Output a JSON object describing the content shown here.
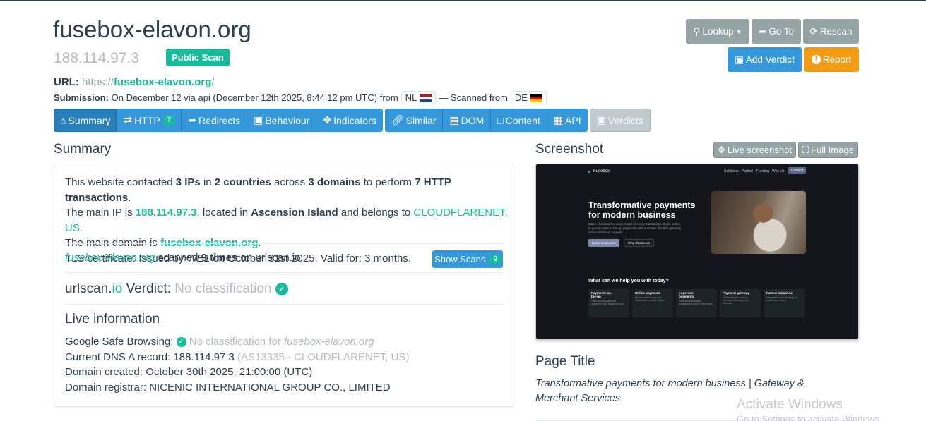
{
  "header": {
    "domain": "fusebox-elavon.org",
    "ip": "188.114.97.3",
    "public_scan": "Public Scan",
    "url_label": "URL:",
    "url_scheme": "https://",
    "url_host": "fusebox-elavon.org",
    "url_path": "/",
    "submission_label": "Submission:",
    "submission_text": "On December 12 via api (December 12th 2025, 8:44:12 pm UTC) from",
    "from_country": "NL",
    "scanned_from_text": "— Scanned from",
    "scanned_country": "DE"
  },
  "actions": {
    "lookup": "Lookup",
    "goto": "Go To",
    "rescan": "Rescan",
    "add_verdict": "Add Verdict",
    "report": "Report"
  },
  "nav": {
    "summary": "Summary",
    "http": "HTTP",
    "http_count": "7",
    "redirects": "Redirects",
    "behaviour": "Behaviour",
    "indicators": "Indicators",
    "similar": "Similar",
    "dom": "DOM",
    "content": "Content",
    "api": "API",
    "verdicts": "Verdicts"
  },
  "summary": {
    "title": "Summary",
    "l1_a": "This website contacted ",
    "ips": "3 IPs",
    "l1_b": " in ",
    "countries": "2 countries",
    "l1_c": " across ",
    "domains": "3 domains",
    "l1_d": " to perform ",
    "transactions": "7 HTTP transactions",
    "l1_e": ".",
    "l2_a": "The main IP is ",
    "main_ip": "188.114.97.3",
    "l2_b": ", located in ",
    "location": "Ascension Island",
    "l2_c": " and belongs to ",
    "asn": "CLOUDFLARENET, US",
    "l2_d": ".",
    "l3_a": "The main domain is ",
    "main_domain": "fusebox-elavon.org",
    "l3_b": ".",
    "l4_a": "TLS certificate: Issued by ",
    "issuer": "WE1",
    "l4_b": " on October 31st 2025. Valid for: 3 months.",
    "scanned_domain": "fusebox-elavon.org",
    "scanned_a": " scanned ",
    "scanned_times": "9 times",
    "scanned_b": " on urlscan.io",
    "show_scans": "Show Scans",
    "scan_count": "9",
    "verdict_a": "urlscan.",
    "verdict_io": "io",
    "verdict_b": " Verdict: ",
    "verdict_value": "No classification",
    "live_title": "Live information",
    "gsb_label": "Google Safe Browsing: ",
    "gsb_value": "No classification for ",
    "gsb_domain": "fusebox-elavon.org",
    "dns_label": "Current DNS A record: 188.114.97.3 ",
    "dns_asn": "(AS13335 - CLOUDFLARENET, US)",
    "created": "Domain created: October 30th 2025, 21:00:00 (UTC)",
    "registrar": "Domain registrar: NICENIC INTERNATIONAL GROUP CO., LIMITED"
  },
  "screenshot": {
    "title": "Screenshot",
    "live_btn": "Live screenshot",
    "full_btn": "Full Image",
    "brand": "Fusebox",
    "nav_items": [
      "Solutions",
      "Partner",
      "Funding",
      "Why Us"
    ],
    "contact": "Contact",
    "hero_1": "Transformative payments",
    "hero_2": "for modern business",
    "hero_sub_1": "Make checkout the easiest part of every transaction. Scale online,",
    "hero_sub_2": "in-person and on-the-go payments with a secure, flexible gateway",
    "hero_sub_3": "and a hands-on support.",
    "cta_1": "Explore solutions",
    "cta_2": "Why choose us",
    "help": "What can we help you with today?",
    "cards": [
      {
        "title": "Payments on-the-go",
        "text": "Take secure payments anywhere your customers are."
      },
      {
        "title": "Online payments",
        "text": "Checkout, invoicing and subscriptions made simple."
      },
      {
        "title": "In-person payments",
        "text": "Fast and contactless experiences built to move lines."
      },
      {
        "title": "Payment gateway",
        "text": "Connect to banks and processors through one interface."
      },
      {
        "title": "Partner solutions",
        "text": "Integrations and offerings to extend your stack."
      }
    ]
  },
  "page_title": {
    "title": "Page Title",
    "value": "Transformative payments for modern business | Gateway & Merchant Services"
  },
  "watermark": {
    "line1": "Activate Windows",
    "line2": "Go to Settings to activate Windows."
  }
}
